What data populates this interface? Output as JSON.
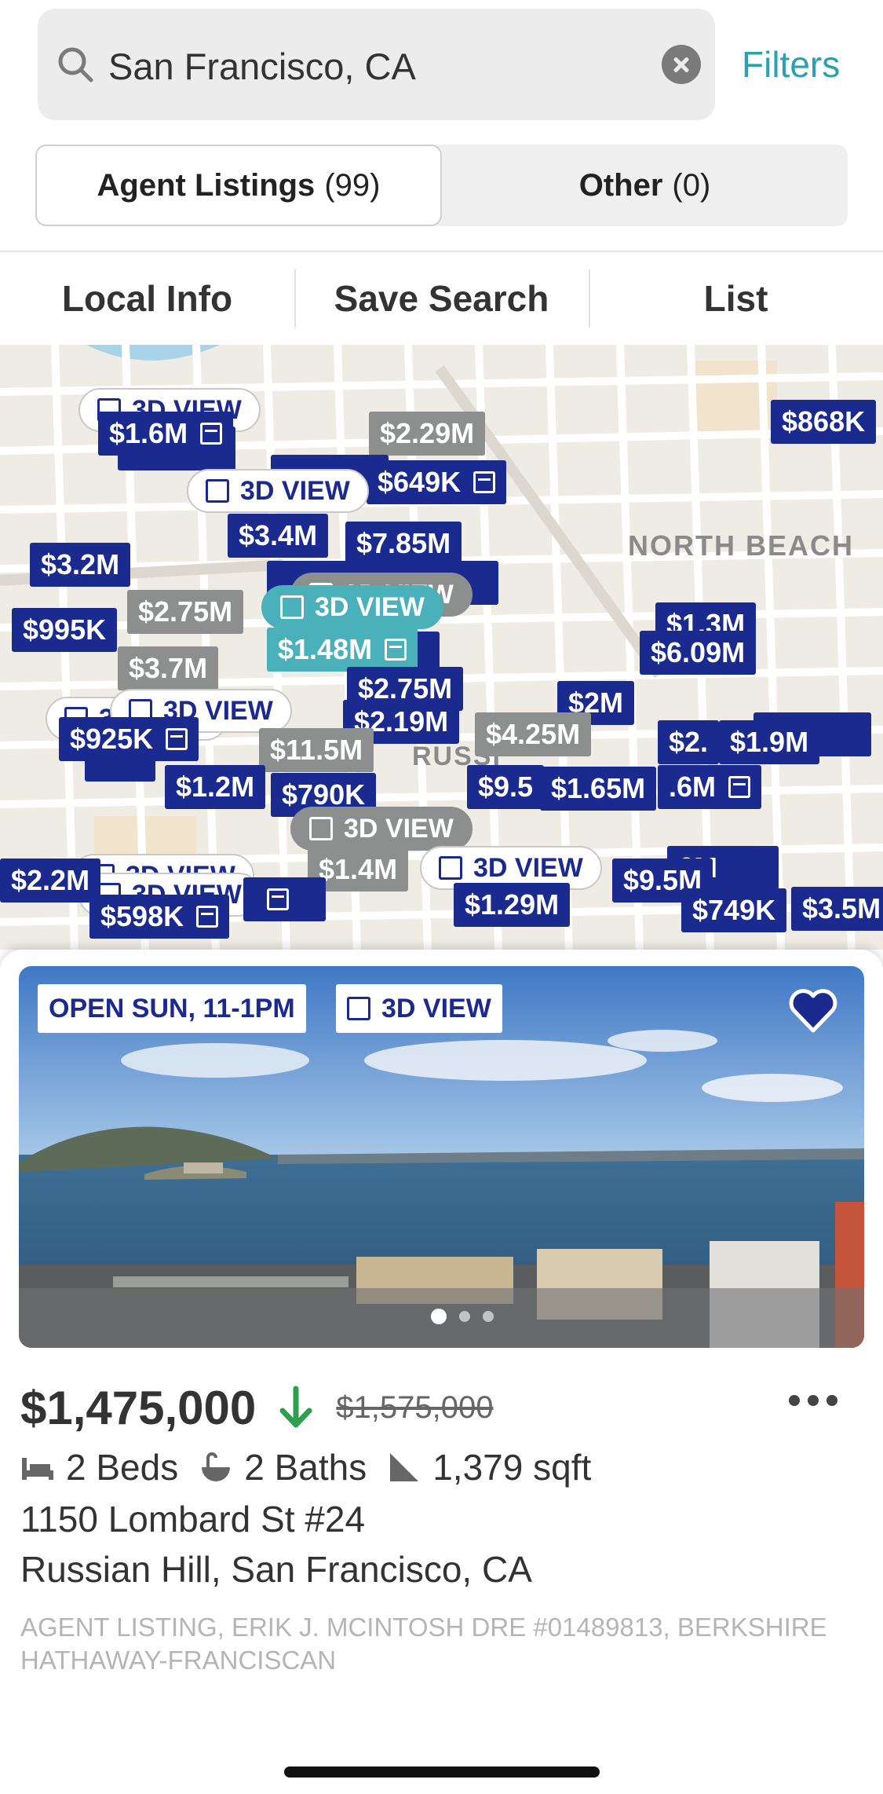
{
  "search": {
    "value": "San Francisco, CA",
    "filters_label": "Filters"
  },
  "segments": [
    {
      "label": "Agent Listings",
      "count": "(99)"
    },
    {
      "label": "Other",
      "count": "(0)"
    }
  ],
  "actions": {
    "local_info": "Local Info",
    "save_search": "Save Search",
    "list": "List"
  },
  "map": {
    "neighborhoods": {
      "north_beach": "NORTH BEACH",
      "russian_hill": "RUSSI"
    },
    "pins": {
      "p1": "$1.6M",
      "p2": "$2.29M",
      "p3": "$868K",
      "p4": "$649K",
      "p5": "$3.4M",
      "p6": "$7.85M",
      "p7": "$3.2M",
      "p8": "$2.75M",
      "p9": "$995K",
      "p10": "$1.48M",
      "p11": "$3.7M",
      "p12": "$1.3M",
      "p13": "$6.09M",
      "p14": "$2.75M",
      "p15": "$2M",
      "p16": "$2.19M",
      "p17": "$4.25M",
      "p18": "$925K",
      "p19": "$11.5M",
      "p20": "$2.",
      "p21": "$1.9M",
      "p22": "$1.2M",
      "p23": "$790K",
      "p24": "$9.5",
      "p25": "$1.65M",
      "p26": ".6M",
      "p27": "$1.4M",
      "p28": "$2.2M",
      "p29": "$598K",
      "p30": "$1.29M",
      "p31": "$9.5M",
      "p32": "6M",
      "p33": "$749K",
      "p34": "$3.5M"
    },
    "view3d": "3D VIEW"
  },
  "listing": {
    "open_house": "OPEN SUN, 11-1PM",
    "view3d": "3D VIEW",
    "price": "$1,475,000",
    "old_price": "$1,575,000",
    "beds": "2 Beds",
    "baths": "2 Baths",
    "sqft": "1,379 sqft",
    "address1": "1150 Lombard St #24",
    "address2": "Russian Hill, San Francisco, CA",
    "agent": "AGENT LISTING, ERIK J. MCINTOSH DRE #01489813, BERKSHIRE HATHAWAY-FRANCISCAN"
  },
  "colors": {
    "accent": "#2ba0b0",
    "pin_navy": "#1a2a8e",
    "pin_gray": "#8d8f8f",
    "pin_teal": "#4ab1ba",
    "price_drop": "#2e9e4f"
  },
  "icons": [
    "search-icon",
    "clear-icon",
    "cube-icon",
    "calendar-icon",
    "heart-icon",
    "down-arrow-icon",
    "more-icon",
    "bed-icon",
    "bath-icon",
    "sqft-icon"
  ]
}
